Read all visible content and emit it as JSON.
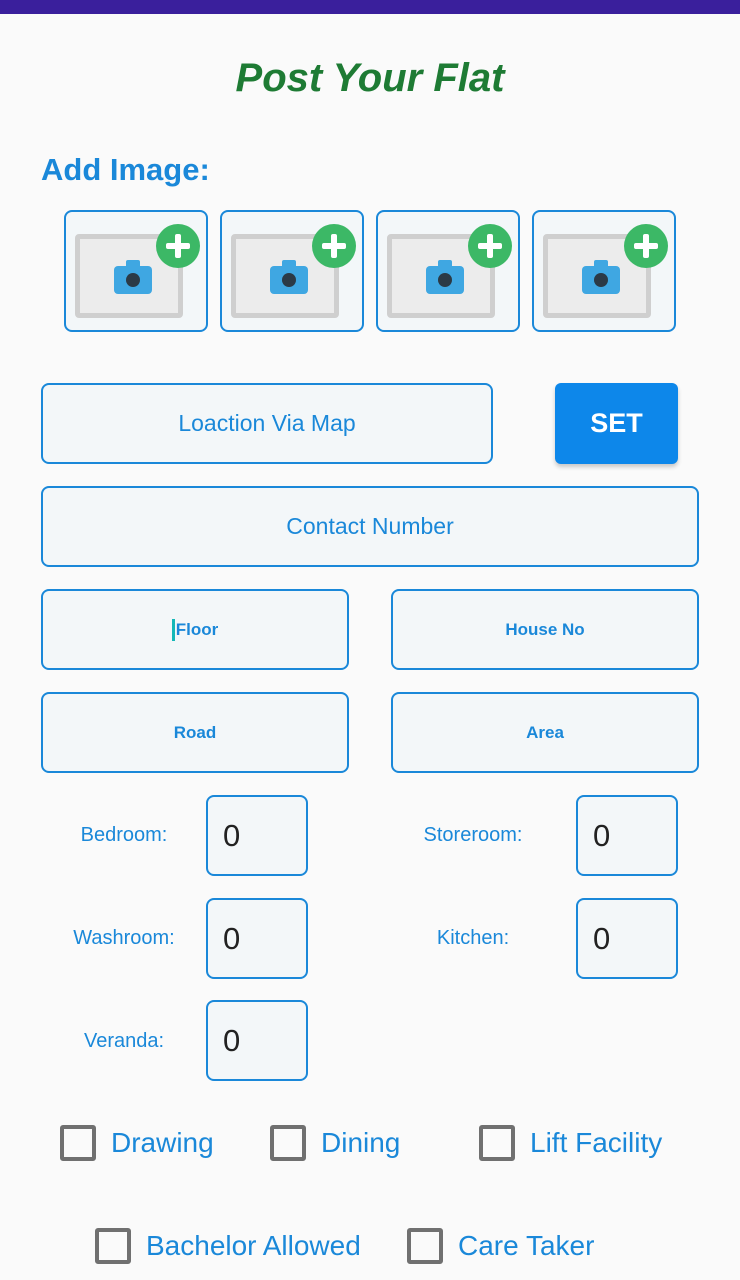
{
  "page": {
    "title": "Post Your Flat",
    "add_image_label": "Add Image:"
  },
  "image_slots": [
    {
      "icon": "camera-icon",
      "add_icon": "plus-icon"
    },
    {
      "icon": "camera-icon",
      "add_icon": "plus-icon"
    },
    {
      "icon": "camera-icon",
      "add_icon": "plus-icon"
    },
    {
      "icon": "camera-icon",
      "add_icon": "plus-icon"
    }
  ],
  "location": {
    "placeholder": "Loaction Via Map",
    "set_label": "SET"
  },
  "fields": {
    "contact": "Contact Number",
    "floor": "Floor",
    "house_no": "House No",
    "road": "Road",
    "area": "Area"
  },
  "counts": {
    "bedroom": {
      "label": "Bedroom:",
      "value": "0"
    },
    "storeroom": {
      "label": "Storeroom:",
      "value": "0"
    },
    "washroom": {
      "label": "Washroom:",
      "value": "0"
    },
    "kitchen": {
      "label": "Kitchen:",
      "value": "0"
    },
    "veranda": {
      "label": "Veranda:",
      "value": "0"
    }
  },
  "checkboxes": {
    "drawing": {
      "label": "Drawing",
      "checked": false
    },
    "dining": {
      "label": "Dining",
      "checked": false
    },
    "lift": {
      "label": "Lift Facility",
      "checked": false
    },
    "bachelor": {
      "label": "Bachelor Allowed",
      "checked": false
    },
    "caretaker": {
      "label": "Care Taker",
      "checked": false
    }
  },
  "colors": {
    "accent": "#1a88d9",
    "title": "#1e7b34",
    "button": "#0d87ea",
    "status_bar": "#3a1f9c",
    "plus": "#3cb866"
  }
}
